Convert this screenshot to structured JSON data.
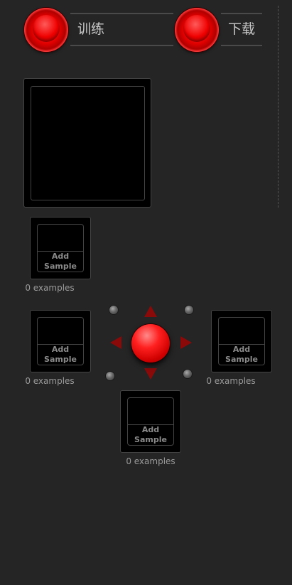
{
  "toolbar": {
    "train_label": "训练",
    "download_label": "下载"
  },
  "samples": [
    {
      "key": "up-left",
      "button_label": "Add\nSample",
      "count_label": "0 examples"
    },
    {
      "key": "left",
      "button_label": "Add\nSample",
      "count_label": "0 examples"
    },
    {
      "key": "right",
      "button_label": "Add\nSample",
      "count_label": "0 examples"
    },
    {
      "key": "down",
      "button_label": "Add\nSample",
      "count_label": "0 examples"
    }
  ],
  "controls": {
    "joystick_icon": "joystick-icon",
    "arrow_icons": [
      "arrow-up-icon",
      "arrow-down-icon",
      "arrow-left-icon",
      "arrow-right-icon"
    ],
    "bolt_icons": [
      "bolt-icon",
      "bolt-icon",
      "bolt-icon",
      "bolt-icon"
    ]
  },
  "colors": {
    "background": "#252525",
    "accent_red": "#e00000",
    "arrow_red": "#8a0a0a",
    "border": "#444444"
  }
}
